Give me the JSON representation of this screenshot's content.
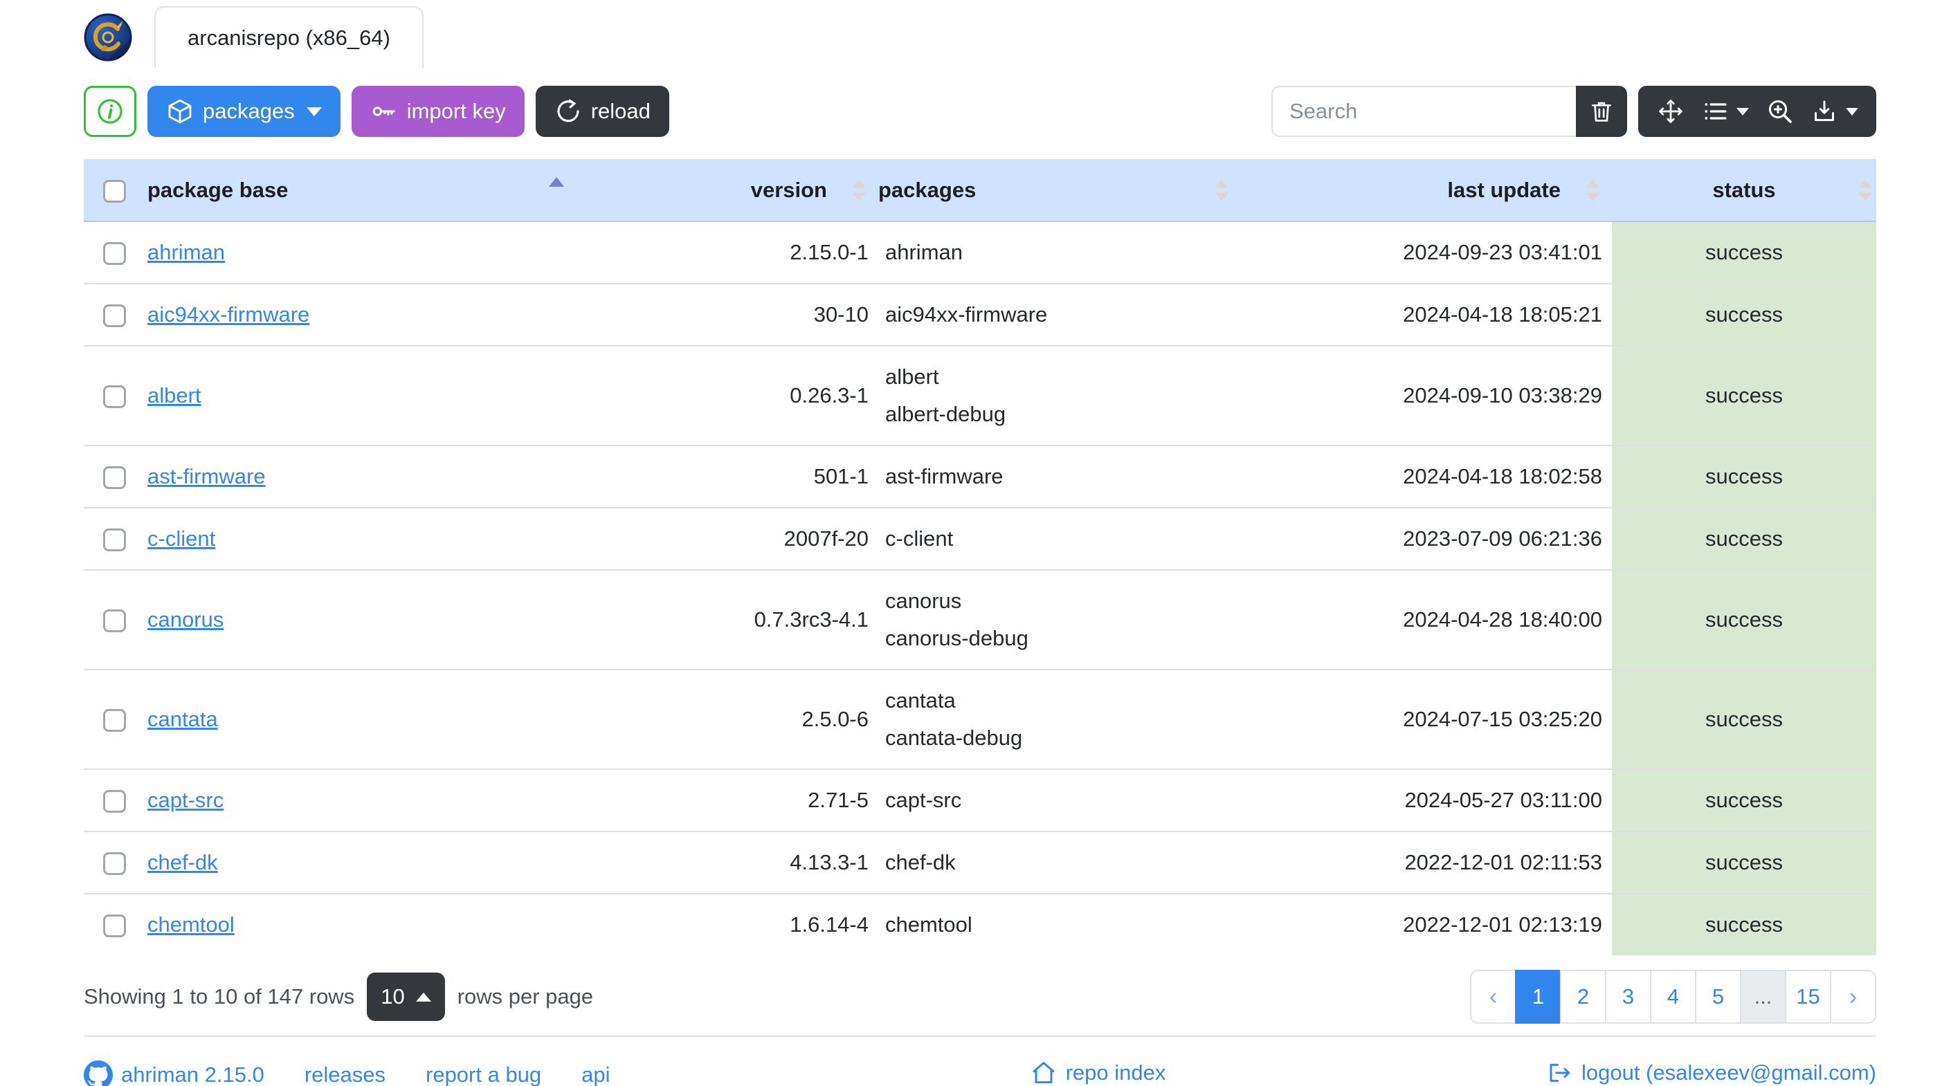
{
  "brand": {
    "tab_title": "arcanisrepo (x86_64)"
  },
  "toolbar": {
    "packages_label": "packages",
    "import_key_label": "import key",
    "reload_label": "reload",
    "search_placeholder": "Search"
  },
  "icons": {
    "logo": "ahriman-repository-logo",
    "info": "info-circle",
    "packages": "cube-box",
    "import_key": "key",
    "reload": "arrow-clockwise",
    "clear_search": "trash",
    "fullscreen": "arrows-move",
    "columns": "list-with-caret",
    "zoom": "magnifier-plus",
    "export": "download-with-caret",
    "github": "github-mark",
    "repo_index": "house",
    "logout": "box-arrow-right"
  },
  "table": {
    "columns": {
      "base": "package base",
      "version": "version",
      "packages": "packages",
      "last_update": "last update",
      "status": "status"
    },
    "sort": {
      "column": "package base",
      "direction": "asc"
    },
    "rows": [
      {
        "base": "ahriman",
        "version": "2.15.0-1",
        "packages": [
          "ahriman"
        ],
        "last_update": "2024-09-23 03:41:01",
        "status": "success"
      },
      {
        "base": "aic94xx-firmware",
        "version": "30-10",
        "packages": [
          "aic94xx-firmware"
        ],
        "last_update": "2024-04-18 18:05:21",
        "status": "success"
      },
      {
        "base": "albert",
        "version": "0.26.3-1",
        "packages": [
          "albert",
          "albert-debug"
        ],
        "last_update": "2024-09-10 03:38:29",
        "status": "success"
      },
      {
        "base": "ast-firmware",
        "version": "501-1",
        "packages": [
          "ast-firmware"
        ],
        "last_update": "2024-04-18 18:02:58",
        "status": "success"
      },
      {
        "base": "c-client",
        "version": "2007f-20",
        "packages": [
          "c-client"
        ],
        "last_update": "2023-07-09 06:21:36",
        "status": "success"
      },
      {
        "base": "canorus",
        "version": "0.7.3rc3-4.1",
        "packages": [
          "canorus",
          "canorus-debug"
        ],
        "last_update": "2024-04-28 18:40:00",
        "status": "success"
      },
      {
        "base": "cantata",
        "version": "2.5.0-6",
        "packages": [
          "cantata",
          "cantata-debug"
        ],
        "last_update": "2024-07-15 03:25:20",
        "status": "success"
      },
      {
        "base": "capt-src",
        "version": "2.71-5",
        "packages": [
          "capt-src"
        ],
        "last_update": "2024-05-27 03:11:00",
        "status": "success"
      },
      {
        "base": "chef-dk",
        "version": "4.13.3-1",
        "packages": [
          "chef-dk"
        ],
        "last_update": "2022-12-01 02:11:53",
        "status": "success"
      },
      {
        "base": "chemtool",
        "version": "1.6.14-4",
        "packages": [
          "chemtool"
        ],
        "last_update": "2022-12-01 02:13:19",
        "status": "success"
      }
    ]
  },
  "pagination": {
    "summary": "Showing 1 to 10 of 147 rows",
    "page_size": "10",
    "suffix": "rows per page",
    "active_page": "1",
    "items": [
      {
        "label": "‹"
      },
      {
        "label": "1"
      },
      {
        "label": "2"
      },
      {
        "label": "3"
      },
      {
        "label": "4"
      },
      {
        "label": "5"
      },
      {
        "label": "..."
      },
      {
        "label": "15"
      },
      {
        "label": "›"
      }
    ]
  },
  "footer": {
    "version_link": "ahriman 2.15.0",
    "releases": "releases",
    "report_bug": "report a bug",
    "api": "api",
    "repo_index": "repo index",
    "logout": "logout (esalexeev@gmail.com)"
  },
  "colors": {
    "primary_blue": "#3287ec",
    "purple": "#a85ad0",
    "dark": "#34383c",
    "green_border": "#35c135",
    "header_bg": "#cfe2ff",
    "success_bg": "#d7e9d0",
    "link": "#3486ec"
  }
}
